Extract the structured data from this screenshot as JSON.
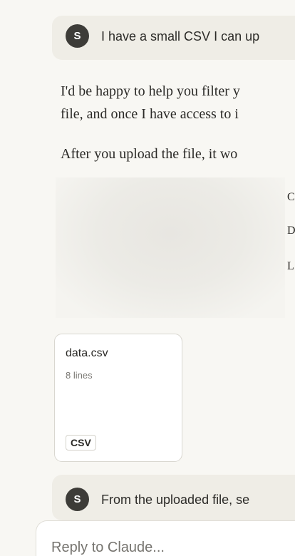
{
  "user_messages": [
    {
      "avatar": "S",
      "text": "I have a small CSV I can up"
    },
    {
      "avatar": "S",
      "text": "From the uploaded file, se"
    }
  ],
  "assistant": {
    "lines": [
      "I'd be happy to help you filter y",
      "file, and once I have access to i",
      "After you upload the file, it wo"
    ],
    "fragments": [
      "C",
      "D",
      "L"
    ]
  },
  "attachment": {
    "name": "data.csv",
    "meta": "8 lines",
    "type": "CSV"
  },
  "composer": {
    "placeholder": "Reply to Claude..."
  }
}
